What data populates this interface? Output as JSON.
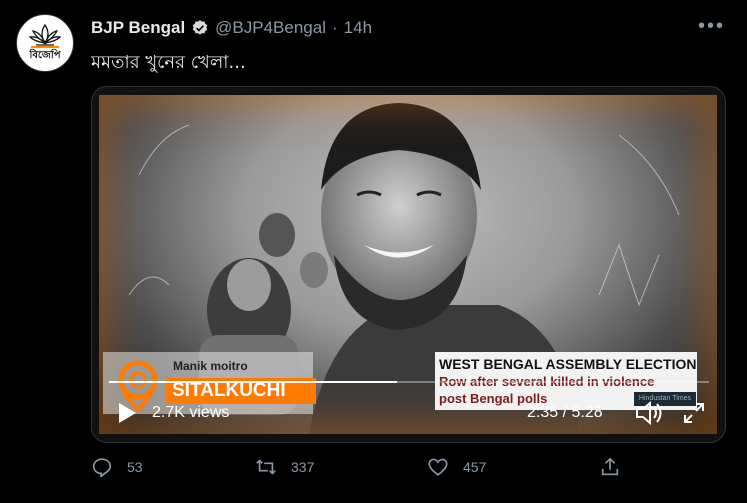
{
  "tweet": {
    "author_name": "BJP Bengal",
    "handle": "@BJP4Bengal",
    "separator": "·",
    "time": "14h",
    "text": "মমতার খুনের খেলা...",
    "avatar_text": "বিজেপি",
    "more_label": "•••"
  },
  "video": {
    "lower_third": {
      "reporter": "Manik moitro",
      "location": "SITALKUCHI"
    },
    "headline": {
      "line1": "WEST BENGAL ASSEMBLY ELECTION",
      "line2": "Row after several killed in violence",
      "line3": "post Bengal polls"
    },
    "source": "Hindustan Times",
    "views": "2.7K views",
    "time_current": "2:35",
    "time_separator": "/",
    "time_total": "5:28",
    "progress_fraction": 0.48
  },
  "actions": {
    "reply_count": "53",
    "retweet_count": "337",
    "like_count": "457"
  },
  "colors": {
    "background": "#000000",
    "muted_text": "#8b98a5",
    "verified": "#1d9bf0",
    "accent_orange": "#ff7a00"
  },
  "icons": [
    "verified-badge-icon",
    "more-icon",
    "play-icon",
    "volume-icon",
    "fullscreen-icon",
    "reply-icon",
    "retweet-icon",
    "like-icon",
    "share-icon",
    "location-pin-icon",
    "lotus-logo-icon"
  ]
}
